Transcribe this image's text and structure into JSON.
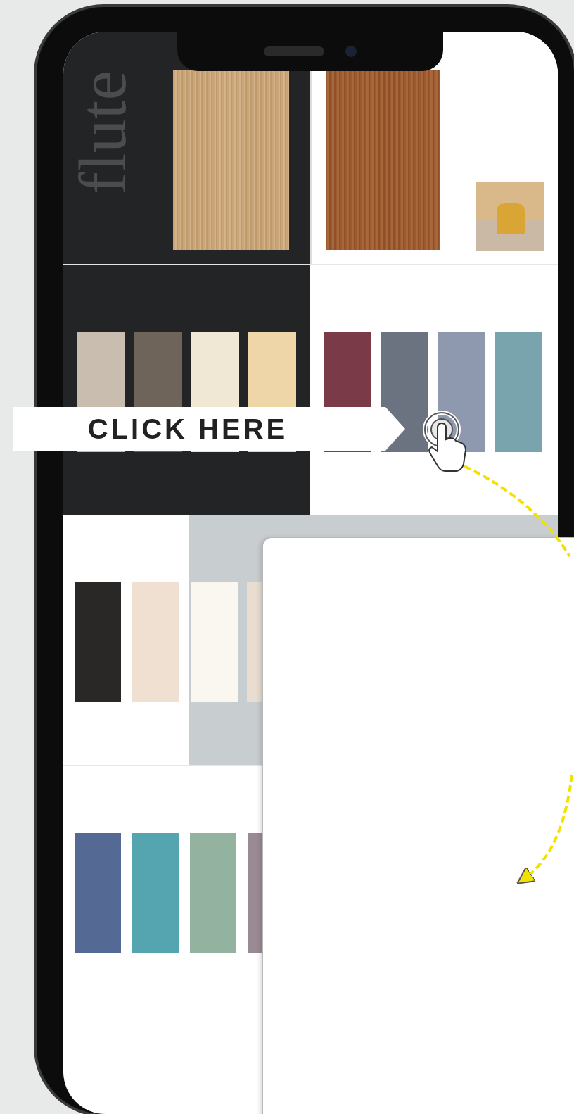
{
  "brand_panel": {
    "title": "flute"
  },
  "palettes": [
    {
      "swatches": [
        {
          "color": "#c8bdae"
        },
        {
          "color": "#6e6459"
        },
        {
          "color": "#f0e8d4"
        },
        {
          "color": "#efd6a8"
        }
      ]
    },
    {
      "swatches": [
        {
          "color": "#7a3a48"
        },
        {
          "color": "#6b7280"
        },
        {
          "color": "#8e98ae"
        },
        {
          "color": "#79a4ad"
        }
      ]
    },
    {
      "swatches": [
        {
          "color": "#2a2826"
        },
        {
          "color": "#f0e0d2"
        }
      ]
    },
    {
      "swatches": [
        {
          "color": "#f9f7f0"
        },
        {
          "color": "#e8ddd0"
        }
      ]
    },
    {
      "swatches": [
        {
          "color": "#546a94"
        },
        {
          "color": "#55a5b0"
        },
        {
          "color": "#93b2a0"
        },
        {
          "color": "#9a8a94"
        }
      ]
    }
  ],
  "callout": {
    "label": "CLICK HERE"
  }
}
